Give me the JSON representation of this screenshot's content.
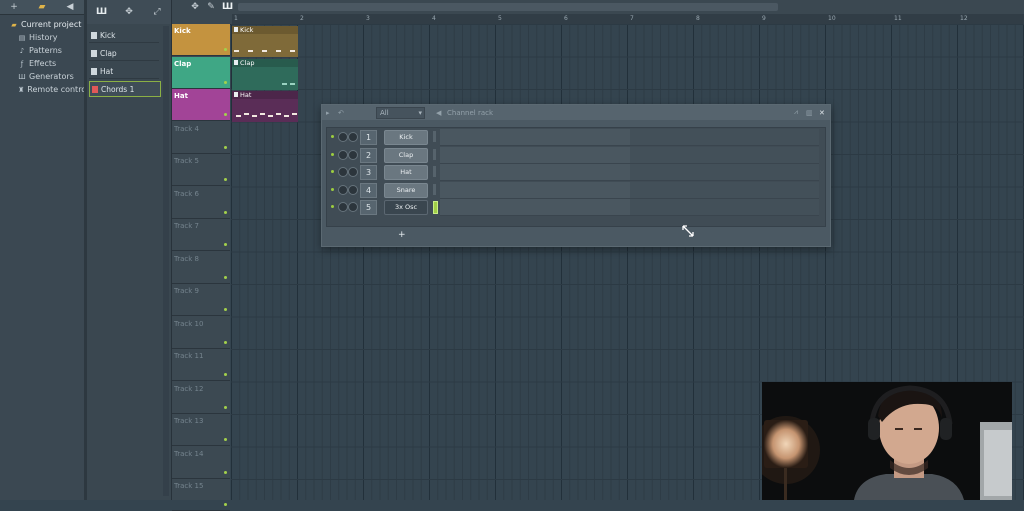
{
  "browser": {
    "toolbar_icons": [
      "plus-icon",
      "folder-icon",
      "speaker-icon"
    ],
    "items": [
      {
        "label": "Current project",
        "icon": "folder-icon",
        "root": true
      },
      {
        "label": "History",
        "icon": "history-icon"
      },
      {
        "label": "Patterns",
        "icon": "note-icon"
      },
      {
        "label": "Effects",
        "icon": "fx-icon"
      },
      {
        "label": "Generators",
        "icon": "generator-icon"
      },
      {
        "label": "Remote control",
        "icon": "remote-icon"
      }
    ]
  },
  "pattern_list": {
    "items": [
      {
        "label": "Kick"
      },
      {
        "label": "Clap"
      },
      {
        "label": "Hat"
      },
      {
        "label": "Chords 1",
        "selected": true
      }
    ]
  },
  "ruler": {
    "bars": [
      "1",
      "2",
      "3",
      "4",
      "5",
      "6",
      "7",
      "8",
      "9",
      "10",
      "11",
      "12"
    ]
  },
  "tracks": [
    {
      "label": "Kick",
      "color": "#c4933f"
    },
    {
      "label": "Clap",
      "color": "#3fa785"
    },
    {
      "label": "Hat",
      "color": "#a24497"
    },
    {
      "label": "Track 4"
    },
    {
      "label": "Track 5"
    },
    {
      "label": "Track 6"
    },
    {
      "label": "Track 7"
    },
    {
      "label": "Track 8"
    },
    {
      "label": "Track 9"
    },
    {
      "label": "Track 10"
    },
    {
      "label": "Track 11"
    },
    {
      "label": "Track 12"
    },
    {
      "label": "Track 13"
    },
    {
      "label": "Track 14"
    },
    {
      "label": "Track 15"
    }
  ],
  "clips": [
    {
      "label": "Kick",
      "color": "#7f6a39"
    },
    {
      "label": "Clap",
      "color": "#2f6b5b"
    },
    {
      "label": "Hat",
      "color": "#5a2d57"
    }
  ],
  "channel_rack": {
    "title": "Channel rack",
    "filter": "All",
    "add_label": "+",
    "channels": [
      {
        "num": "1",
        "name": "Kick"
      },
      {
        "num": "2",
        "name": "Clap"
      },
      {
        "num": "3",
        "name": "Hat"
      },
      {
        "num": "4",
        "name": "Snare"
      },
      {
        "num": "5",
        "name": "3x Osc",
        "selected": true
      }
    ]
  }
}
